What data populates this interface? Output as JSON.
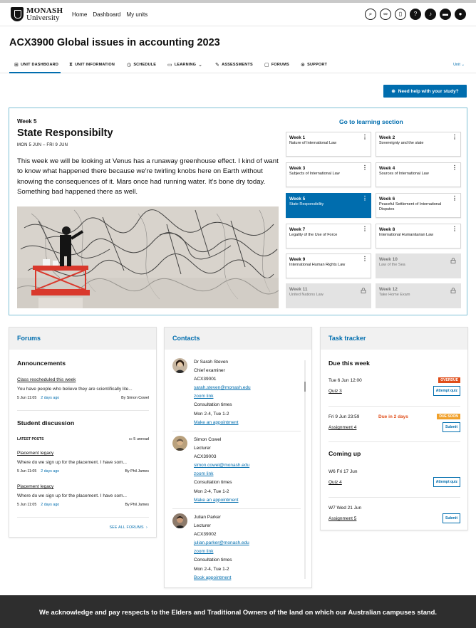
{
  "header": {
    "logo_line1": "MONASH",
    "logo_line2": "University",
    "nav": [
      "Home",
      "Dashboard",
      "My units"
    ],
    "icons": [
      "search-icon",
      "link-icon",
      "book-icon",
      "help-icon",
      "bell-icon",
      "chat-icon",
      "user-icon"
    ]
  },
  "page": {
    "title": "ACX3900 Global issues in accounting 2023"
  },
  "tabs": [
    {
      "label": "UNIT DASHBOARD",
      "icon": "grid-icon"
    },
    {
      "label": "UNIT INFORMATION",
      "icon": "hourglass-icon"
    },
    {
      "label": "SCHEDULE",
      "icon": "clock-icon"
    },
    {
      "label": "LEARNING",
      "icon": "book-icon"
    },
    {
      "label": "ASSESSMENTS",
      "icon": "assessment-icon"
    },
    {
      "label": "FORUMS",
      "icon": "chat-icon"
    },
    {
      "label": "SUPPORT",
      "icon": "lifebuoy-icon"
    }
  ],
  "unit_dropdown": "Unit",
  "help_button": "Need help with your study?",
  "week": {
    "label": "Week 5",
    "title": "State Responsibilty",
    "dates": "MON 5 JUN – FRI 9 JUN",
    "body": "This week we will be looking at Venus has a runaway greenhouse effect. I kind of want to know what happened there because we're twirling knobs here on Earth without knowing the consequences of it. Mars once had running water. It's bone dry today. Something bad happened there as well.",
    "go_learning": "Go to learning section",
    "cards": [
      {
        "n": "Week 1",
        "t": "Nature of International Law",
        "state": "normal"
      },
      {
        "n": "Week 2",
        "t": "Sovereignty and the state",
        "state": "normal"
      },
      {
        "n": "Week 3",
        "t": "Subjects of International Law",
        "state": "normal"
      },
      {
        "n": "Week 4",
        "t": "Sources of International Law",
        "state": "normal"
      },
      {
        "n": "Week 5",
        "t": "State Responsibility",
        "state": "active"
      },
      {
        "n": "Week 6",
        "t": "Peaceful Settlement of International Disputes",
        "state": "normal"
      },
      {
        "n": "Week 7",
        "t": "Legality of the Use of Force",
        "state": "normal"
      },
      {
        "n": "Week 8",
        "t": "International Humanitarian Law",
        "state": "normal"
      },
      {
        "n": "Week 9",
        "t": "International Human Rights Law",
        "state": "normal"
      },
      {
        "n": "Week 10",
        "t": "Law of the Sea",
        "state": "locked"
      },
      {
        "n": "Week 11",
        "t": "United Nations Law",
        "state": "locked"
      },
      {
        "n": "Week 12",
        "t": "Take Home Exam",
        "state": "locked"
      }
    ]
  },
  "forums": {
    "title": "Forums",
    "announcements_title": "Announcements",
    "announcement": {
      "title": "Class rescheduled this week",
      "body": "You have people who believe they are scientifically lite...",
      "time": "5 Jun 11:05",
      "ago": "2 days ago",
      "by": "By Simon Cowel"
    },
    "discussion_title": "Student discussion",
    "latest_label": "LATEST POSTS",
    "unread": "5 unread",
    "posts": [
      {
        "title": "Placement legacy",
        "body": "Where do we sign up for the placement. I have som...",
        "time": "5 Jun 11:05",
        "ago": "2 days ago",
        "by": "By Phil James"
      },
      {
        "title": "Placement legacy",
        "body": "Where do we sign up for the placement. I have som...",
        "time": "5 Jun 11:05",
        "ago": "2 days ago",
        "by": "By Phil James"
      }
    ],
    "see_all": "SEE ALL FORUMS"
  },
  "contacts": {
    "title": "Contacts",
    "people": [
      {
        "name": "Dr Sarah Steven",
        "role": "Chief examiner",
        "code": "ACX39001",
        "email": "sarah.steven@monash.edu",
        "zoom": "zoom link",
        "consult": "Consultation times",
        "times": "Mon 2-4, Tue 1-2",
        "action": "Make an appointment"
      },
      {
        "name": "Simon Cowel",
        "role": "Lecturer",
        "code": "ACX39003",
        "email": "simon.cowel@monash.edu",
        "zoom": "zoom link",
        "consult": "Consultation times",
        "times": "Mon 2-4, Tue 1-2",
        "action": "Make an appointment"
      },
      {
        "name": "Julian Parker",
        "role": "Lecturer",
        "code": "ACX39002",
        "email": "julian.parker@monash.edu",
        "zoom": "zoom link",
        "consult": "Consultation times",
        "times": "Mon 2-4, Tue 1-2",
        "action": "Book appointment"
      }
    ]
  },
  "tasks": {
    "title": "Task tracker",
    "due_title": "Due this week",
    "coming_title": "Coming up",
    "due": [
      {
        "when": "Tue 6 Jun 12:00",
        "name": "Quiz 3",
        "badge": "OVERDUE",
        "badge_color": "#e04e1a",
        "note": "",
        "action": "Attempt quiz"
      },
      {
        "when": "Fri 9 Jun 23:59",
        "name": "Assignment 4",
        "badge": "DUE SOON",
        "badge_color": "#f0a02a",
        "note": "Due in 2 days",
        "action": "Submit"
      }
    ],
    "coming": [
      {
        "when": "W6 Fri 17 Jun",
        "name": "Quiz 4",
        "action": "Attempt quiz"
      },
      {
        "when": "W7 Wed 21 Jun",
        "name": "Assignment 5",
        "action": "Submit"
      }
    ]
  },
  "footer": {
    "text": "We acknowledge and pay respects to the Elders and Traditional Owners of the land on which our Australian campuses stand."
  },
  "colors": {
    "accent": "#006dae",
    "overdue": "#e04e1a",
    "due_soon": "#f0a02a",
    "footer_bg": "#2e2e2e"
  }
}
